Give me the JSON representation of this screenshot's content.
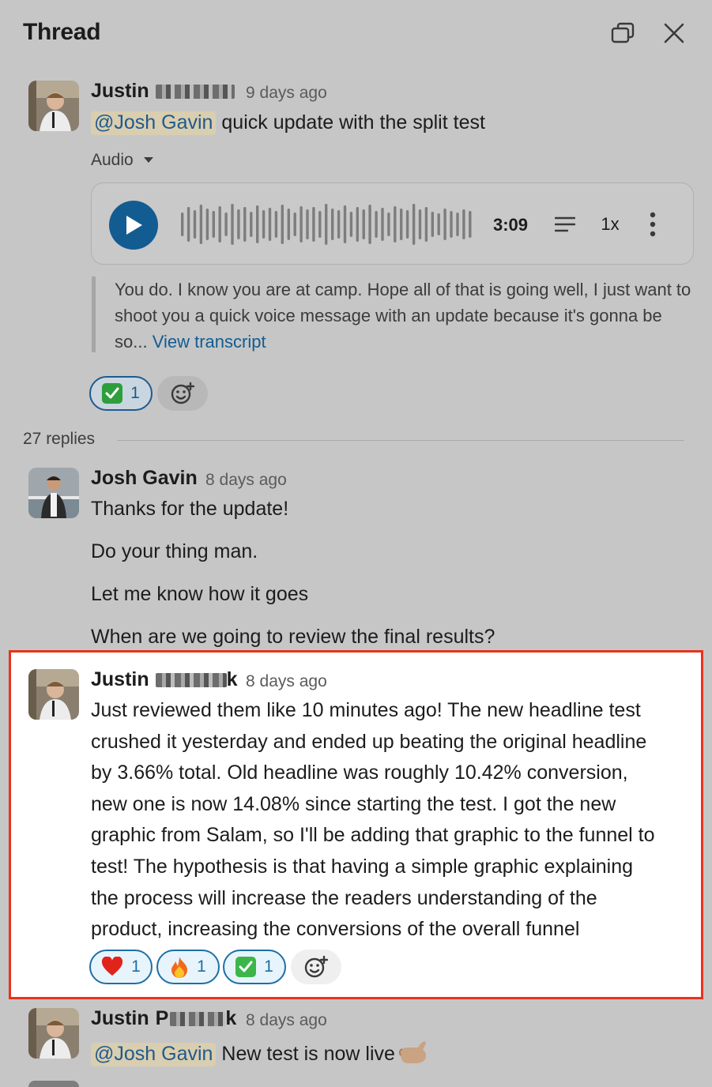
{
  "header": {
    "title": "Thread"
  },
  "messages": [
    {
      "author_first": "Justin",
      "time": "9 days ago",
      "mention": "@Josh Gavin",
      "text": "quick update with the split test",
      "audio_label": "Audio",
      "audio": {
        "duration": "3:09",
        "speed": "1x",
        "transcript": "You do. I know you are at camp. Hope all of that is going well, I just want to shoot you a quick voice message with an update because it's gonna be so...",
        "transcript_link": "View transcript"
      },
      "reactions": [
        {
          "emoji": "white-check-mark",
          "count": "1"
        }
      ]
    },
    {
      "author": "Josh Gavin",
      "time": "8 days ago",
      "lines": [
        "Thanks for the update!",
        "Do your thing man.",
        "Let me know how it goes",
        "When are we going to review the final results?"
      ]
    },
    {
      "author_first": "Justin",
      "author_last_visible": "k",
      "time": "8 days ago",
      "lines": [
        "Just reviewed them like 10 minutes ago! The new headline test",
        "crushed it yesterday and ended up beating the original headline",
        "by 3.66% total. Old headline was roughly 10.42% conversion,",
        "new one is now 14.08% since starting the test. I got the new",
        "graphic from Salam, so I'll be adding that graphic to the funnel to",
        "test! The hypothesis is that having a simple graphic explaining",
        "the process will increase the readers understanding of the",
        "product, increasing the conversions of the overall funnel"
      ],
      "reactions": [
        {
          "emoji": "heart",
          "count": "1"
        },
        {
          "emoji": "fire",
          "count": "1"
        },
        {
          "emoji": "white-check-mark",
          "count": "1"
        }
      ]
    },
    {
      "author_first": "Justin",
      "author_partial": "P",
      "author_last_visible": "k",
      "time": "8 days ago",
      "mention": "@Josh Gavin",
      "text": "New test is now live"
    }
  ],
  "replies_count": "27 replies",
  "colors": {
    "accent": "#135c92",
    "highlight_border": "#e8321c",
    "overlay_bg": "#c6c6c6"
  }
}
